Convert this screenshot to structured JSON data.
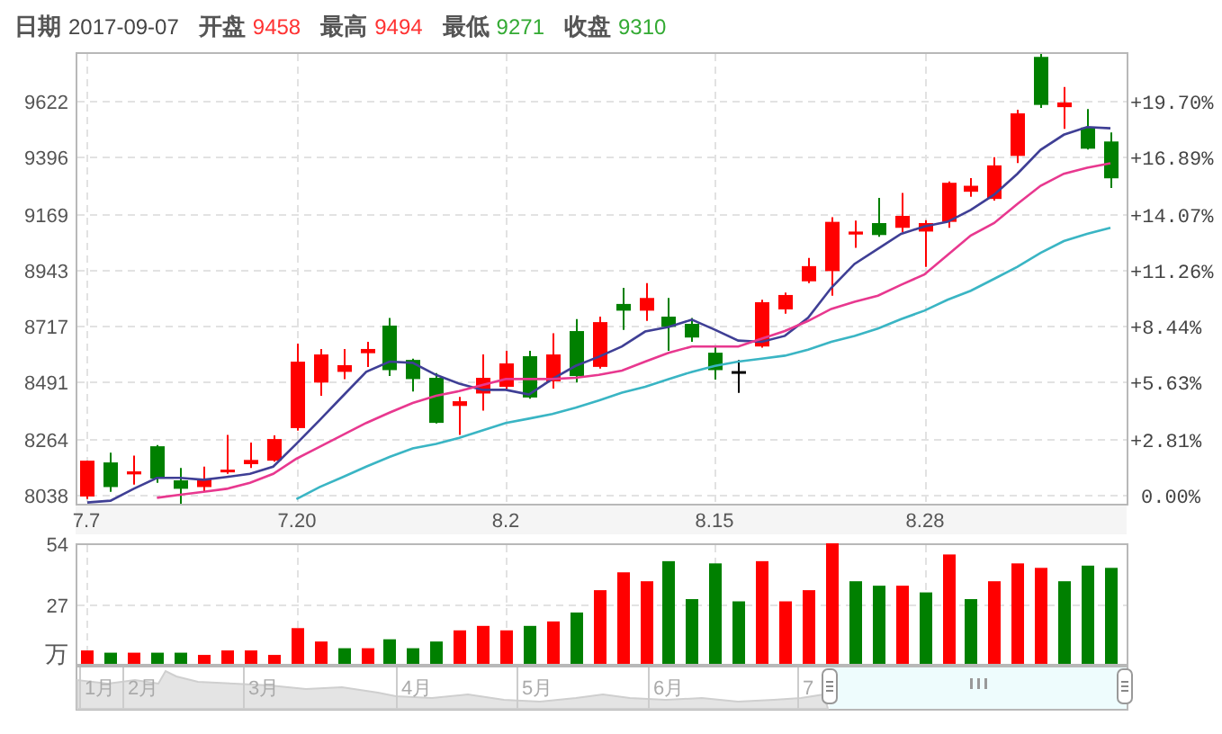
{
  "quote": [
    {
      "label": "日期",
      "value": "2017-09-07",
      "color": "#444444"
    },
    {
      "label": "开盘",
      "value": "9458",
      "color": "#ff3333"
    },
    {
      "label": "最高",
      "value": "9494",
      "color": "#ff3333"
    },
    {
      "label": "最低",
      "value": "9271",
      "color": "#33aa33"
    },
    {
      "label": "收盘",
      "value": "9310",
      "color": "#33aa33"
    }
  ],
  "price_chart": {
    "chart_data": {
      "type": "candlestick",
      "grid": true,
      "categories": [
        "7.7",
        null,
        null,
        null,
        null,
        null,
        null,
        null,
        null,
        "7.20",
        null,
        null,
        null,
        null,
        null,
        null,
        null,
        null,
        "8.2",
        null,
        null,
        null,
        null,
        null,
        null,
        null,
        null,
        "8.15",
        null,
        null,
        null,
        null,
        null,
        null,
        null,
        null,
        "8.28",
        null,
        null,
        null,
        null,
        null,
        null,
        null,
        null
      ],
      "ylim": [
        8002,
        9817
      ],
      "yticks": [
        8038,
        8264,
        8491,
        8717,
        8943,
        9169,
        9396,
        9622
      ],
      "y2ticks": [
        "0.00%",
        "+2.81%",
        "+5.63%",
        "+8.44%",
        "+11.26%",
        "+14.07%",
        "+16.89%",
        "+19.70%"
      ],
      "ohlc": [
        [
          8031,
          8175,
          8021,
          8175
        ],
        [
          8168,
          8207,
          8050,
          8069
        ],
        [
          8120,
          8195,
          8079,
          8132
        ],
        [
          8233,
          8238,
          8086,
          8103
        ],
        [
          8096,
          8146,
          8002,
          8062
        ],
        [
          8069,
          8151,
          8050,
          8103
        ],
        [
          8130,
          8279,
          8122,
          8139
        ],
        [
          8161,
          8248,
          8146,
          8178
        ],
        [
          8175,
          8277,
          8171,
          8262
        ],
        [
          8306,
          8646,
          8296,
          8573
        ],
        [
          8489,
          8624,
          8436,
          8602
        ],
        [
          8532,
          8624,
          8503,
          8559
        ],
        [
          8607,
          8653,
          8552,
          8624
        ],
        [
          8718,
          8749,
          8515,
          8539
        ],
        [
          8580,
          8585,
          8453,
          8503
        ],
        [
          8508,
          8527,
          8325,
          8327
        ],
        [
          8395,
          8431,
          8279,
          8414
        ],
        [
          8445,
          8602,
          8376,
          8508
        ],
        [
          8472,
          8617,
          8460,
          8566
        ],
        [
          8595,
          8617,
          8424,
          8429
        ],
        [
          8494,
          8687,
          8465,
          8602
        ],
        [
          8696,
          8744,
          8489,
          8515
        ],
        [
          8552,
          8754,
          8545,
          8732
        ],
        [
          8805,
          8870,
          8701,
          8778
        ],
        [
          8778,
          8889,
          8737,
          8829
        ],
        [
          8754,
          8829,
          8617,
          8713
        ],
        [
          8725,
          8749,
          8653,
          8670
        ],
        [
          8609,
          8634,
          8501,
          8539
        ],
        [
          8535,
          8580,
          8448,
          8535
        ],
        [
          8634,
          8822,
          8629,
          8812
        ],
        [
          8783,
          8851,
          8766,
          8841
        ],
        [
          8896,
          8990,
          8889,
          8957
        ],
        [
          8937,
          9154,
          8838,
          9135
        ],
        [
          9084,
          9140,
          9031,
          9096
        ],
        [
          9130,
          9231,
          9075,
          9082
        ],
        [
          9111,
          9251,
          9094,
          9159
        ],
        [
          9096,
          9142,
          8954,
          9130
        ],
        [
          9135,
          9297,
          9111,
          9292
        ],
        [
          9256,
          9311,
          9236,
          9280
        ],
        [
          9227,
          9395,
          9220,
          9362
        ],
        [
          9400,
          9586,
          9371,
          9571
        ],
        [
          9798,
          9810,
          9593,
          9605
        ],
        [
          9596,
          9677,
          9509,
          9615
        ],
        [
          9514,
          9588,
          9426,
          9429
        ],
        [
          9458,
          9494,
          9271,
          9310
        ]
      ],
      "series": [
        {
          "type": "line",
          "color": "#3f3f95",
          "values": [
            8007,
            8014,
            8062,
            8106,
            8106,
            8098,
            8110,
            8122,
            8151,
            8243,
            8339,
            8436,
            8532,
            8573,
            8568,
            8520,
            8484,
            8460,
            8460,
            8441,
            8503,
            8556,
            8593,
            8634,
            8694,
            8713,
            8742,
            8701,
            8658,
            8653,
            8677,
            8749,
            8870,
            8966,
            9027,
            9087,
            9116,
            9135,
            9183,
            9244,
            9328,
            9424,
            9485,
            9516,
            9511
          ]
        },
        {
          "type": "line",
          "color": "#e8388f",
          "values": [
            null,
            null,
            null,
            8026,
            8038,
            8050,
            8062,
            8086,
            8122,
            8183,
            8231,
            8279,
            8327,
            8368,
            8407,
            8436,
            8455,
            8479,
            8503,
            8503,
            8503,
            8508,
            8520,
            8537,
            8573,
            8609,
            8634,
            8634,
            8634,
            8665,
            8696,
            8737,
            8785,
            8814,
            8838,
            8882,
            8923,
            9002,
            9080,
            9130,
            9207,
            9280,
            9328,
            9352,
            9371
          ]
        },
        {
          "type": "line",
          "color": "#3ab5c4",
          "values": [
            null,
            null,
            null,
            null,
            null,
            null,
            null,
            null,
            null,
            8021,
            8069,
            8110,
            8151,
            8190,
            8224,
            8243,
            8267,
            8296,
            8327,
            8344,
            8363,
            8388,
            8417,
            8448,
            8472,
            8503,
            8532,
            8556,
            8573,
            8585,
            8597,
            8621,
            8653,
            8677,
            8706,
            8744,
            8778,
            8822,
            8858,
            8906,
            8954,
            9010,
            9058,
            9087,
            9111
          ]
        }
      ]
    }
  },
  "volume_chart": {
    "chart_data": {
      "type": "bar",
      "grid": true,
      "ylabel": "万",
      "categories": [
        null,
        null,
        null,
        null,
        null,
        null,
        null,
        null,
        null,
        null,
        null,
        null,
        null,
        null,
        null,
        null,
        null,
        null,
        null,
        null,
        null,
        null,
        null,
        null,
        null,
        null,
        null,
        null,
        null,
        null,
        null,
        null,
        null,
        null,
        null,
        null,
        null,
        null,
        null,
        null,
        null,
        null,
        null,
        null,
        null
      ],
      "ylim": [
        0,
        54
      ],
      "yticks": [
        27,
        54
      ],
      "series": [
        {
          "color": "#ff0000",
          "values": [
            6,
            null,
            5,
            null,
            null,
            4,
            6,
            6,
            4,
            16,
            10,
            null,
            7,
            null,
            null,
            null,
            15,
            17,
            15,
            null,
            19,
            null,
            33,
            41,
            37,
            null,
            null,
            null,
            null,
            46,
            28,
            33,
            54,
            null,
            null,
            35,
            null,
            49,
            null,
            37,
            45,
            43,
            null,
            null,
            null
          ]
        },
        {
          "color": "#008000",
          "values": [
            null,
            5,
            null,
            5,
            5,
            null,
            null,
            null,
            null,
            null,
            null,
            7,
            null,
            11,
            7,
            10,
            null,
            null,
            null,
            17,
            null,
            23,
            null,
            null,
            null,
            46,
            29,
            45,
            28,
            null,
            null,
            null,
            null,
            37,
            35,
            null,
            32,
            null,
            29,
            null,
            null,
            null,
            37,
            44,
            43
          ]
        }
      ]
    }
  },
  "navigator": {
    "months": [
      "1月",
      "2月",
      "3月",
      "4月",
      "5月",
      "6月",
      "7"
    ]
  }
}
